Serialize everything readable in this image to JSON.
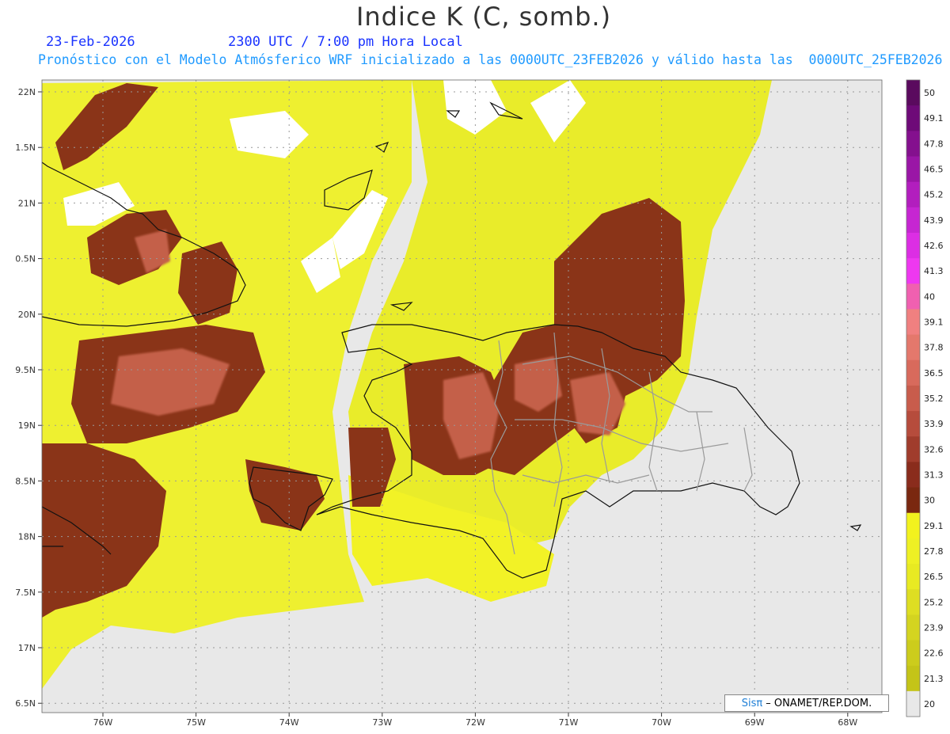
{
  "header": {
    "title": "Indice K (C, somb.)",
    "date": "23-Feb-2026",
    "time": "2300 UTC / 7:00 pm Hora Local",
    "info": "Pronóstico con el Modelo Atmósferico WRF inicializado a las 0000UTC_23FEB2026 y válido hasta las  0000UTC_25FEB2026"
  },
  "map": {
    "lat_labels": [
      "22N",
      "1.5N",
      "21N",
      "0.5N",
      "20N",
      "9.5N",
      "19N",
      "8.5N",
      "18N",
      "7.5N",
      "17N",
      "6.5N"
    ],
    "lon_labels": [
      "76W",
      "75W",
      "74W",
      "73W",
      "72W",
      "71W",
      "70W",
      "69W",
      "68W"
    ],
    "lat_range": [
      16.5,
      22.0
    ],
    "lon_range": [
      -76.6,
      -67.6
    ],
    "grid": true
  },
  "legend": {
    "labels": [
      "50",
      "49.1",
      "47.8",
      "46.5",
      "45.2",
      "43.9",
      "42.6",
      "41.3",
      "40",
      "39.1",
      "37.8",
      "36.5",
      "35.2",
      "33.9",
      "32.6",
      "31.3",
      "30",
      "29.1",
      "27.8",
      "26.5",
      "25.2",
      "23.9",
      "22.6",
      "21.3",
      "20"
    ],
    "colors": [
      "#5a0a5e",
      "#6e0a78",
      "#84108e",
      "#9a16a6",
      "#b21ebe",
      "#c626d2",
      "#dc2ee4",
      "#ee38f0",
      "#f060b0",
      "#f08080",
      "#e4786c",
      "#d86a5c",
      "#c85c4c",
      "#b64c3c",
      "#a03c2c",
      "#8a2c1c",
      "#7a2810",
      "#f2f21e",
      "#eef024",
      "#e8ea22",
      "#dede22",
      "#d4d420",
      "#cccc1c",
      "#c4c418",
      "#e8e8e8"
    ]
  },
  "credit": {
    "brand": "Sisπ",
    "text": "– ONAMET/REP.DOM."
  },
  "colors": {
    "land_bg": "#e8e8e8",
    "title_blue": "#1a33ff",
    "info_blue": "#1f9aff"
  }
}
